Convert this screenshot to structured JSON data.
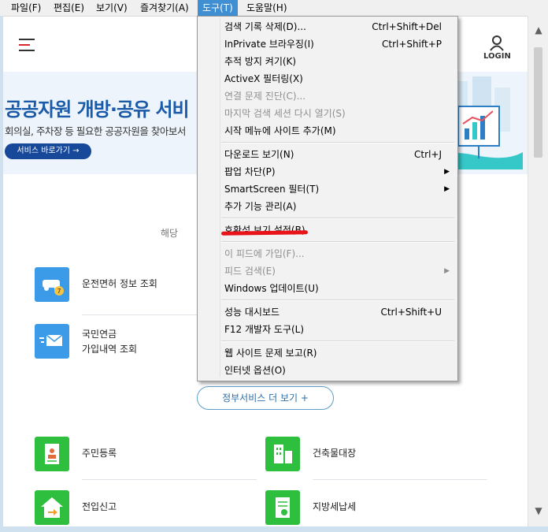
{
  "menubar": {
    "items": [
      "파일(F)",
      "편집(E)",
      "보기(V)",
      "즐겨찾기(A)",
      "도구(T)",
      "도움말(H)"
    ],
    "active_index": 4
  },
  "header": {
    "login_label": "LOGIN"
  },
  "banner": {
    "title": "공공자원 개방·공유 서비",
    "subtitle": "회의실, 주차장 등 필요한 공공자원을 찾아보서",
    "button_label": "서비스 바로가기 →"
  },
  "main": {
    "hint_text": "해당",
    "services_top": [
      {
        "label": "운전면허 정보 조회",
        "icon": "car-license-icon"
      },
      {
        "label": "국민연금\n가입내역 조회",
        "icon": "mail-icon"
      }
    ],
    "more_button": "정부서비스 더 보기  +",
    "services_bottom": [
      {
        "label": "주민등록",
        "icon": "resident-card-icon"
      },
      {
        "label": "건축물대장",
        "icon": "building-icon"
      },
      {
        "label": "전입신고",
        "icon": "house-move-icon"
      },
      {
        "label": "지방세납세",
        "icon": "tax-document-icon"
      }
    ]
  },
  "tools_menu": {
    "items": [
      {
        "label": "검색 기록 삭제(D)...",
        "shortcut": "Ctrl+Shift+Del",
        "enabled": true,
        "submenu": false
      },
      {
        "label": "InPrivate 브라우징(I)",
        "shortcut": "Ctrl+Shift+P",
        "enabled": true,
        "submenu": false
      },
      {
        "label": "추적 방지 켜기(K)",
        "shortcut": "",
        "enabled": true,
        "submenu": false
      },
      {
        "label": "ActiveX 필터링(X)",
        "shortcut": "",
        "enabled": true,
        "submenu": false
      },
      {
        "label": "연결 문제 진단(C)...",
        "shortcut": "",
        "enabled": false,
        "submenu": false
      },
      {
        "label": "마지막 검색 세션 다시 열기(S)",
        "shortcut": "",
        "enabled": false,
        "submenu": false
      },
      {
        "label": "시작 메뉴에 사이트 추가(M)",
        "shortcut": "",
        "enabled": true,
        "submenu": false
      },
      {
        "label": "다운로드 보기(N)",
        "shortcut": "Ctrl+J",
        "enabled": true,
        "submenu": false
      },
      {
        "label": "팝업 차단(P)",
        "shortcut": "",
        "enabled": true,
        "submenu": true
      },
      {
        "label": "SmartScreen 필터(T)",
        "shortcut": "",
        "enabled": true,
        "submenu": true
      },
      {
        "label": "추가 기능 관리(A)",
        "shortcut": "",
        "enabled": true,
        "submenu": false
      },
      {
        "label": "호환성 보기 설정(B)",
        "shortcut": "",
        "enabled": true,
        "submenu": false
      },
      {
        "label": "이 피드에 가입(F)...",
        "shortcut": "",
        "enabled": false,
        "submenu": false
      },
      {
        "label": "피드 검색(E)",
        "shortcut": "",
        "enabled": false,
        "submenu": true
      },
      {
        "label": "Windows 업데이트(U)",
        "shortcut": "",
        "enabled": true,
        "submenu": false
      },
      {
        "label": "성능 대시보드",
        "shortcut": "Ctrl+Shift+U",
        "enabled": true,
        "submenu": false
      },
      {
        "label": "F12 개발자 도구(L)",
        "shortcut": "",
        "enabled": true,
        "submenu": false
      },
      {
        "label": "웹 사이트 문제 보고(R)",
        "shortcut": "",
        "enabled": true,
        "submenu": false
      },
      {
        "label": "인터넷 옵션(O)",
        "shortcut": "",
        "enabled": true,
        "submenu": false
      }
    ]
  },
  "colors": {
    "menu_highlight": "#3f8fd2",
    "banner_title": "#1a5aa8",
    "banner_button": "#17489a",
    "annotation_underline": "#e8141a",
    "icon_blue": "#3b9be8",
    "icon_green": "#2fbf3f"
  }
}
